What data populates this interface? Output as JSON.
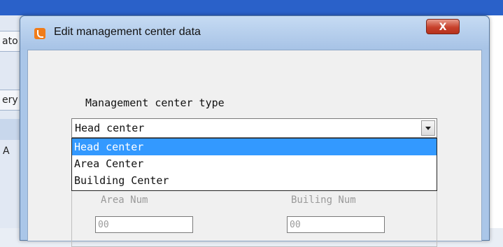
{
  "background": {
    "tab1_label": "ato",
    "tab2_label": "ery",
    "row_label": "A"
  },
  "dialog": {
    "title": "Edit management center data",
    "close_label": "X",
    "type_label": "Management center type",
    "combo": {
      "selected": "Head center",
      "options": [
        "Head center",
        "Area Center",
        "Building Center"
      ],
      "highlighted_index": 0
    },
    "fields": {
      "area_num_label": "Area Num",
      "area_num_value": "00",
      "building_num_label": "Builing Num",
      "building_num_value": "00"
    }
  },
  "colors": {
    "title_bar": "#a7c3e6",
    "close_button": "#c7412c",
    "selection": "#3399ff",
    "taskbar_blue": "#2a61c9"
  }
}
